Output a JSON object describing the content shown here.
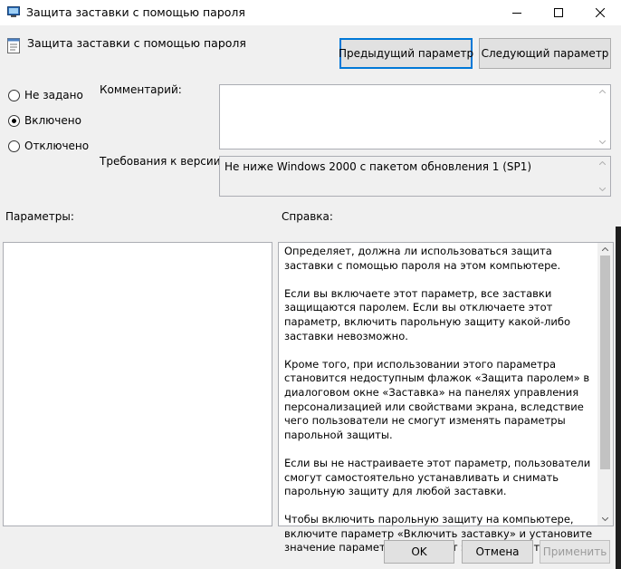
{
  "window": {
    "title": "Защита заставки с помощью пароля"
  },
  "policy": {
    "name": "Защита заставки с помощью пароля"
  },
  "nav": {
    "previous": "Предыдущий параметр",
    "next": "Следующий параметр"
  },
  "state": {
    "options": [
      {
        "label": "Не задано",
        "selected": false
      },
      {
        "label": "Включено",
        "selected": true
      },
      {
        "label": "Отключено",
        "selected": false
      }
    ]
  },
  "comment": {
    "label": "Комментарий:",
    "value": ""
  },
  "supported": {
    "label": "Требования к версии:",
    "value": "Не ниже Windows 2000 с пакетом обновления 1 (SP1)"
  },
  "options_panel": {
    "label": "Параметры:"
  },
  "help": {
    "label": "Справка:",
    "paragraphs": [
      "Определяет, должна ли использоваться защита заставки с помощью пароля на этом компьютере.",
      "Если вы включаете этот параметр, все заставки защищаются паролем. Если вы отключаете этот параметр, включить парольную защиту какой-либо заставки невозможно.",
      "Кроме того, при использовании этого параметра становится недоступным флажок «Защита паролем» в диалоговом окне «Заставка» на панелях управления персонализацией или свойствами экрана, вследствие чего пользователи не смогут изменять параметры парольной защиты.",
      "Если вы не настраиваете этот параметр, пользователи смогут самостоятельно устанавливать и снимать парольную защиту для любой заставки.",
      "Чтобы включить парольную защиту на компьютере, включите параметр «Включить заставку» и установите значение параметра «Тайм-аут экранной заставки»."
    ]
  },
  "footer": {
    "ok": "OK",
    "cancel": "Отмена",
    "apply": "Применить"
  },
  "colors": {
    "accent": "#0078d7",
    "window_bg": "#f0f0f0"
  },
  "icons": [
    "app-icon",
    "policy-icon",
    "minimize-icon",
    "maximize-icon",
    "close-icon",
    "radio-icon",
    "scroll-up-icon",
    "scroll-down-icon"
  ]
}
